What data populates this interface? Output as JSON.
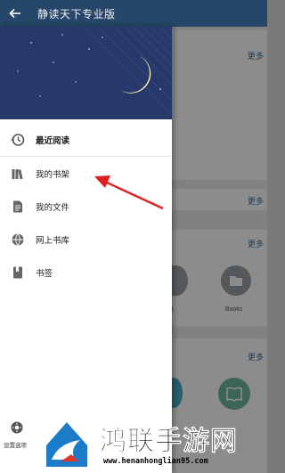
{
  "app": {
    "title": "静读天下专业版",
    "more_label": "更多",
    "books_label": "Books",
    "fragment_label": "ent"
  },
  "drawer": {
    "items": [
      {
        "label": "最近阅读",
        "icon": "history-icon",
        "active": true
      },
      {
        "label": "我的书架",
        "icon": "bookshelf-icon",
        "active": false
      },
      {
        "label": "我的文件",
        "icon": "file-icon",
        "active": false
      },
      {
        "label": "网上书库",
        "icon": "globe-icon",
        "active": false
      },
      {
        "label": "书签",
        "icon": "bookmark-icon",
        "active": false
      }
    ],
    "settings_label": "设置选项"
  },
  "colors": {
    "title_bar": "#26466a",
    "drawer_header": "#27396b",
    "accent": "#3a6f97",
    "annotation_arrow": "#e02020"
  },
  "watermark": {
    "name": "鸿联手游网",
    "url": "www.henanhonglian95.com"
  }
}
